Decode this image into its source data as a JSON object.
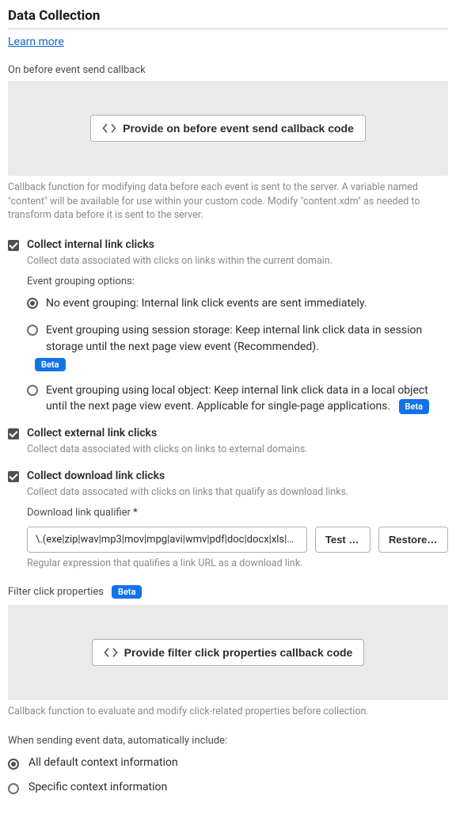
{
  "title": "Data Collection",
  "learn_more": "Learn more",
  "before_send": {
    "label": "On before event send callback",
    "button": "Provide on before event send callback code",
    "help": "Callback function for modifying data before each event is sent to the server. A variable named \"content\" will be available for use within your custom code. Modify \"content.xdm\" as needed to transform data before it is sent to the server."
  },
  "internal_clicks": {
    "title": "Collect internal link clicks",
    "desc": "Collect data associated with clicks on links within the current domain.",
    "grouping_label": "Event grouping options:",
    "options": {
      "none": "No event grouping: Internal link click events are sent immediately.",
      "session": "Event grouping using session storage: Keep internal link click data in session storage until the next page view event (Recommended).",
      "local": "Event grouping using local object: Keep internal link click data in a local object until the next page view event. Applicable for single-page applications."
    }
  },
  "external_clicks": {
    "title": "Collect external link clicks",
    "desc": "Collect data associated with clicks on links to external domains."
  },
  "download_clicks": {
    "title": "Collect download link clicks",
    "desc": "Collect data assocated with clicks on links that qualify as download links.",
    "qualifier_label": "Download link qualifier",
    "qualifier_value": "\\.(exe|zip|wav|mp3|mov|mpg|avi|wmv|pdf|doc|docx|xls|xlsx|ppt|pptx)$",
    "test_button": "Test regex",
    "restore_button": "Restore default",
    "qualifier_help": "Regular expression that qualifies a link URL as a download link."
  },
  "filter_click": {
    "label": "Filter click properties",
    "button": "Provide filter click properties callback code",
    "help": "Callback function to evaluate and modify click-related properties before collection."
  },
  "context": {
    "label": "When sending event data, automatically include:",
    "all": "All default context information",
    "specific": "Specific context information"
  },
  "beta": "Beta"
}
